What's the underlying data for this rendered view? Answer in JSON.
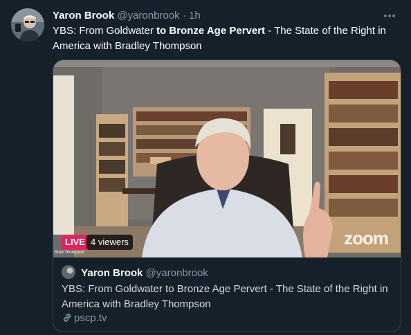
{
  "tweet": {
    "author_name": "Yaron Brook",
    "handle": "@yaronbrook",
    "separator": "·",
    "timestamp": "1h",
    "text_before": "YBS: From Goldwater ",
    "text_bold_to": "to",
    "text_mid": " ",
    "text_bold_name": "Bronze Age Pervert",
    "text_after": " - The State of the Right in America with Bradley Thompson"
  },
  "video": {
    "live_label": "LIVE",
    "viewers": "4 viewers",
    "name_tag": "Brad Thompson",
    "watermark": "zoom"
  },
  "quote": {
    "author_name": "Yaron Brook",
    "handle": "@yaronbrook",
    "text": "YBS: From Goldwater to Bronze Age Pervert - The State of the Right in America with Bradley Thompson",
    "link": "pscp.tv"
  },
  "colors": {
    "background": "#15202b",
    "secondary_text": "#8899a6",
    "border": "#38444d",
    "live": "#e0245e"
  },
  "icons": [
    "more-icon",
    "link-icon"
  ]
}
